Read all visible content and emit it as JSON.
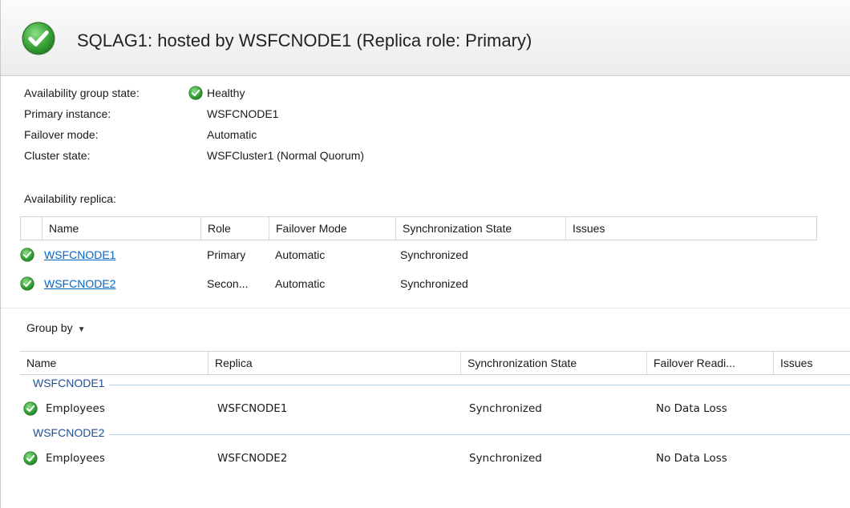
{
  "header": {
    "title": "SQLAG1: hosted by WSFCNODE1 (Replica role: Primary)",
    "status_icon": "check-circle-icon"
  },
  "summary": {
    "rows": [
      {
        "label": "Availability group state:",
        "value": "Healthy"
      },
      {
        "label": "Primary instance:",
        "value": "WSFCNODE1"
      },
      {
        "label": "Failover mode:",
        "value": "Automatic"
      },
      {
        "label": "Cluster state:",
        "value": "WSFCluster1 (Normal Quorum)"
      }
    ]
  },
  "replicas": {
    "label": "Availability replica:",
    "columns": [
      "Name",
      "Role",
      "Failover Mode",
      "Synchronization State",
      "Issues"
    ],
    "rows": [
      {
        "name": "WSFCNODE1",
        "role": "Primary",
        "failover": "Automatic",
        "sync": "Synchronized",
        "issues": ""
      },
      {
        "name": "WSFCNODE2",
        "role": "Secon...",
        "failover": "Automatic",
        "sync": "Synchronized",
        "issues": ""
      }
    ]
  },
  "group_by": {
    "label": "Group by"
  },
  "databases": {
    "columns": [
      "Name",
      "Replica",
      "Synchronization State",
      "Failover Readi...",
      "Issues"
    ],
    "groups": [
      {
        "title": "WSFCNODE1",
        "rows": [
          {
            "name": "Employees",
            "replica": "WSFCNODE1",
            "sync": "Synchronized",
            "readiness": "No Data Loss"
          }
        ]
      },
      {
        "title": "WSFCNODE2",
        "rows": [
          {
            "name": "Employees",
            "replica": "WSFCNODE2",
            "sync": "Synchronized",
            "readiness": "No Data Loss"
          }
        ]
      }
    ]
  },
  "colors": {
    "accent_link": "#0066cc",
    "group_header": "#1f4f96",
    "check_green": "#3aa63a"
  }
}
